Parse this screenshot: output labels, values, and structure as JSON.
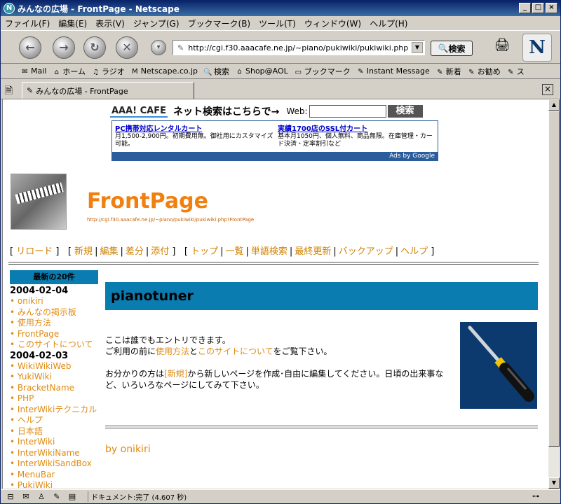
{
  "window": {
    "title": "みんなの広場 - FrontPage - Netscape"
  },
  "menu": [
    "ファイル(F)",
    "編集(E)",
    "表示(V)",
    "ジャンプ(G)",
    "ブックマーク(B)",
    "ツール(T)",
    "ウィンドウ(W)",
    "ヘルプ(H)"
  ],
  "nav": {
    "url": "http://cgi.f30.aaacafe.ne.jp/~piano/pukiwiki/pukiwiki.php",
    "search_label": "検索"
  },
  "bookmarks": [
    "Mail",
    "ホーム",
    "ラジオ",
    "Netscape.co.jp",
    "検索",
    "Shop@AOL",
    "ブックマーク",
    "Instant Message",
    "新着",
    "お勧め",
    "ス"
  ],
  "tab": {
    "label": "みんなの広場 - FrontPage"
  },
  "ad": {
    "brand": "AAA! CAFE",
    "tagline": "ネット検索はこちらで→",
    "web_label": "Web:",
    "search_button": "検索",
    "ad1_title": "PC携帯対応レンタルカート",
    "ad1_body": "月1,500-2,900円。初期費用無。御社用にカスタマイズ可能。",
    "ad2_title": "実績1700店のSSL付カート",
    "ad2_body": "基本月1050円、個人無料、商品無限。在庫管理・カード決済・定率割引など",
    "footer": "Ads by Google"
  },
  "page": {
    "title": "FrontPage",
    "url": "http://cgi.f30.aaacafe.ne.jp/~piano/pukiwiki/pukiwiki.php?FrontPage"
  },
  "links": {
    "reload": "リロード",
    "new": "新規",
    "edit": "編集",
    "diff": "差分",
    "attach": "添付",
    "top": "トップ",
    "list": "一覧",
    "search": "単語検索",
    "recent": "最終更新",
    "backup": "バックアップ",
    "help": "ヘルプ"
  },
  "sidebar": {
    "heading": "最新の20件",
    "date1": "2004-02-04",
    "items1": [
      "onikiri",
      "みんなの掲示板",
      "使用方法",
      "FrontPage",
      "このサイトについて"
    ],
    "date2": "2004-02-03",
    "items2": [
      "WikiWikiWeb",
      "YukiWiki",
      "BracketName",
      "PHP",
      "InterWikiテクニカル",
      "ヘルプ",
      "日本語",
      "InterWiki",
      "InterWikiName",
      "InterWikiSandBox",
      "MenuBar",
      "PukiWiki"
    ]
  },
  "main": {
    "heading": "pianotuner",
    "line1": "ここは誰でもエントリできます。",
    "line2a": "ご利用の前に",
    "line2_link1": "使用方法",
    "line2b": "と",
    "line2_link2": "このサイトについて",
    "line2c": "をご覧下さい。",
    "line3a": "お分かりの方は",
    "line3_link": "[新規]",
    "line3b": "から新しいページを作成･自由に編集してください。日頃の出来事など、いろいろなページにしてみて下さい。",
    "byline": "by onikiri"
  },
  "status": {
    "text": "ドキュメント:完了 (4.607 秒)"
  }
}
